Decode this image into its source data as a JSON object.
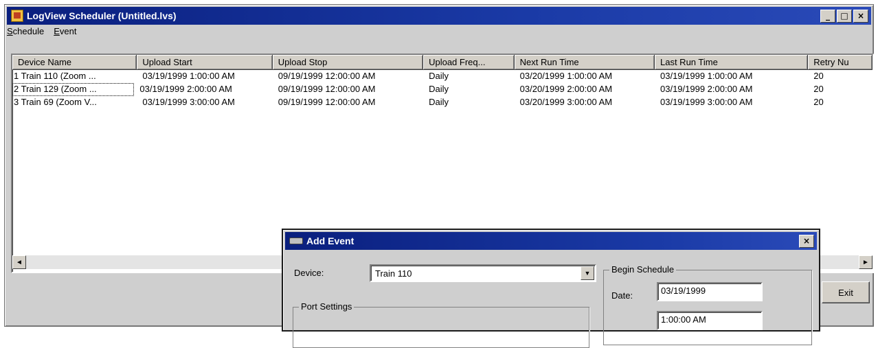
{
  "window": {
    "title": "LogView Scheduler (Untitled.lvs)",
    "controls": {
      "minimize": "_",
      "maximize": "□",
      "close": "×"
    }
  },
  "menu": [
    {
      "accel": "S",
      "rest": "chedule"
    },
    {
      "accel": "E",
      "rest": "vent"
    }
  ],
  "table": {
    "columns": [
      "Device Name",
      "Upload Start",
      "Upload Stop",
      "Upload Freq...",
      "Next Run Time",
      "Last Run Time",
      "Retry Nu"
    ],
    "rows": [
      [
        "1  Train 110 (Zoom ...",
        "03/19/1999 1:00:00 AM",
        "09/19/1999 12:00:00 AM",
        "Daily",
        "03/20/1999 1:00:00 AM",
        "03/19/1999 1:00:00 AM",
        "20"
      ],
      [
        "2  Train 129 (Zoom ...",
        "03/19/1999 2:00:00 AM",
        "09/19/1999 12:00:00 AM",
        "Daily",
        "03/20/1999 2:00:00 AM",
        "03/19/1999 2:00:00 AM",
        "20"
      ],
      [
        "3  Train 69 (Zoom V...",
        "03/19/1999 3:00:00 AM",
        "09/19/1999 12:00:00 AM",
        "Daily",
        "03/20/1999 3:00:00 AM",
        "03/19/1999 3:00:00 AM",
        "20"
      ]
    ]
  },
  "scroll": {
    "left": "◄",
    "right": "►"
  },
  "exit_label": "Exit",
  "dialog": {
    "title": "Add Event",
    "close": "×",
    "device_label": "Device:",
    "device_value": "Train 110",
    "drop": "▼",
    "port_settings_label": "Port Settings",
    "begin_schedule_label": "Begin Schedule",
    "date_label": "Date:",
    "date_value": "03/19/1999",
    "time_value": "1:00:00 AM"
  }
}
